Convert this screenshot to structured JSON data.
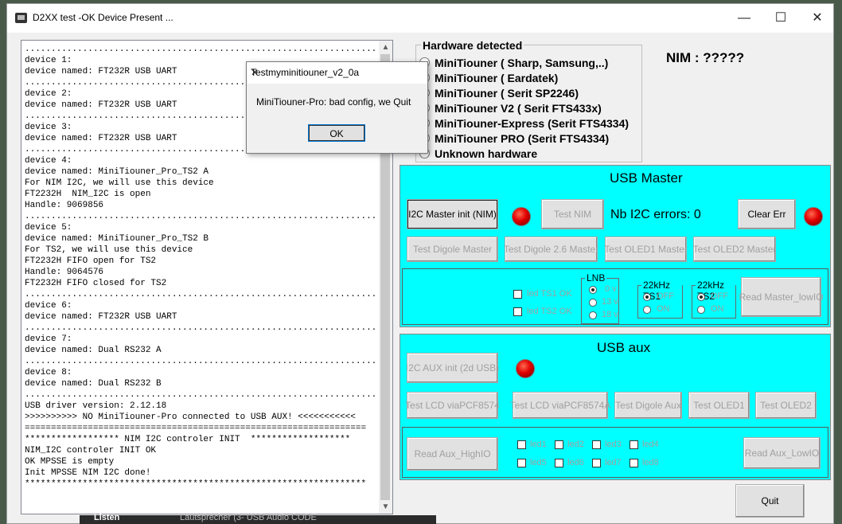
{
  "window": {
    "title": "D2XX test -OK Device Present ...",
    "minimize": "—",
    "maximize": "☐",
    "close": "✕"
  },
  "log_lines": [
    "...................................................................",
    "device 1:",
    "device named: FT232R USB UART",
    "...................................................................",
    "device 2:",
    "device named: FT232R USB UART",
    "...................................................................",
    "device 3:",
    "device named: FT232R USB UART",
    "...................................................................",
    "device 4:",
    "device named: MiniTiouner_Pro_TS2 A",
    "For NIM I2C, we will use this device",
    "FT2232H  NIM_I2C is open",
    "Handle: 9069856",
    "...................................................................",
    "device 5:",
    "device named: MiniTiouner_Pro_TS2 B",
    "For TS2, we will use this device",
    "FT2232H FIFO open for TS2",
    "Handle: 9064576",
    "FT2232H FIFO closed for TS2",
    "...................................................................",
    "device 6:",
    "device named: FT232R USB UART",
    "...................................................................",
    "device 7:",
    "device named: Dual RS232 A",
    "...................................................................",
    "device 8:",
    "device named: Dual RS232 B",
    "...................................................................",
    "USB driver version: 2.12.18",
    ">>>>>>>>>> NO MiniTiouner-Pro connected to USB AUX! <<<<<<<<<<<",
    "=================================================================",
    "****************** NIM I2C controler INIT  *******************",
    "NIM_I2C controler INIT OK",
    "OK MPSSE is empty",
    "Init MPSSE NIM I2C done!",
    "*****************************************************************"
  ],
  "dialog": {
    "title": "Testmyminitiouner_v2_0a",
    "message": "MiniTiouner-Pro: bad config, we Quit",
    "ok": "OK",
    "close": "✕"
  },
  "hardware": {
    "legend": "Hardware detected",
    "options": [
      "MiniTiouner ( Sharp, Samsung,..)",
      "MiniTiouner ( Eardatek)",
      "MiniTiouner ( Serit SP2246)",
      "MiniTiouner V2 ( Serit FTS433x)",
      "MiniTiouner-Express (Serit FTS4334)",
      "MiniTiouner PRO  (Serit FTS4334)",
      "Unknown hardware"
    ]
  },
  "nim_label": "NIM : ?????",
  "usb_master": {
    "title": "USB Master",
    "i2c_init": "I2C Master init (NIM)",
    "test_nim": "Test NIM",
    "errors": "Nb I2C errors: 0",
    "clear_err": "Clear Err",
    "test_digole": "Test Digole Master",
    "test_digole26": "Test Digole 2.6 Master",
    "test_oled1": "Test OLED1 Master",
    "test_oled2": "Test OLED2 Master",
    "led_ts1": "led TS1 OK",
    "led_ts2": "led TS2 OK",
    "lnb": {
      "legend": "LNB",
      "opts": [
        "0 v",
        "13 v",
        "18 v"
      ]
    },
    "ts1": {
      "legend": "22kHz TS1",
      "off": "OFF",
      "on": "ON"
    },
    "ts2": {
      "legend": "22kHz TS2",
      "off": "OFF",
      "on": "ON"
    },
    "read_low": "Read Master_lowIO"
  },
  "usb_aux": {
    "title": "USB aux",
    "i2c_init": "I2C AUX init (2d USB)",
    "lcd": "Test LCD viaPCF8574",
    "lcd_a": "Test LCD viaPCF8574A",
    "digole": "Test Digole Aux",
    "oled1": "Test OLED1",
    "oled2": "Test OLED2",
    "read_high": "Read Aux_HighIO",
    "read_low": "Read Aux_LowIO",
    "leds": [
      "led1",
      "led2",
      "led3",
      "led4",
      "led5",
      "led6",
      "led7",
      "led8"
    ]
  },
  "quit": "Quit",
  "taskbar": {
    "left": "Listen",
    "right": "Lautsprecher (3- USB Audio CODE"
  },
  "colors": {
    "panel": "#00ffff",
    "led": "#e00000"
  }
}
